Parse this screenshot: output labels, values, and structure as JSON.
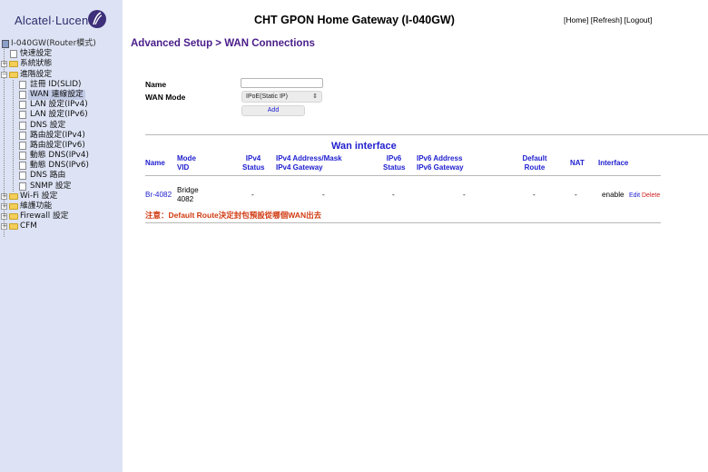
{
  "header": {
    "logo_text": "Alcatel·Lucent",
    "title": "CHT GPON Home Gateway (I-040GW)",
    "links": {
      "home": "[Home]",
      "refresh": "[Refresh]",
      "logout": "[Logout]"
    }
  },
  "sidebar": {
    "root": "I-040GW(Router模式)",
    "items": [
      {
        "label": "快速設定"
      },
      {
        "label": "系統狀態"
      },
      {
        "label": "進階設定"
      },
      {
        "label": "註冊 ID(SLID)"
      },
      {
        "label": "WAN 連線設定"
      },
      {
        "label": "LAN 設定(IPv4)"
      },
      {
        "label": "LAN 設定(IPv6)"
      },
      {
        "label": "DNS 設定"
      },
      {
        "label": "路由設定(IPv4)"
      },
      {
        "label": "路由設定(IPv6)"
      },
      {
        "label": "動態 DNS(IPv4)"
      },
      {
        "label": "動態 DNS(IPv6)"
      },
      {
        "label": "DNS 路由"
      },
      {
        "label": "SNMP 設定"
      },
      {
        "label": "Wi-Fi 設定"
      },
      {
        "label": "維護功能"
      },
      {
        "label": "Firewall 設定"
      },
      {
        "label": "CFM"
      }
    ]
  },
  "main": {
    "breadcrumb": "Advanced Setup > WAN Connections",
    "form": {
      "name_label": "Name",
      "name_value": "",
      "wan_mode_label": "WAN Mode",
      "wan_mode_value": "IPoE(Static IP)",
      "add_label": "Add"
    },
    "wan_table": {
      "title": "Wan interface",
      "headers": {
        "name": "Name",
        "mode": "Mode",
        "vid": "VID",
        "ipv4_status_1": "IPv4",
        "ipv4_status_2": "Status",
        "ipv4_addr_1": "IPv4 Address/Mask",
        "ipv4_addr_2": "IPv4 Gateway",
        "ipv6_status_1": "IPv6",
        "ipv6_status_2": "Status",
        "ipv6_addr_1": "IPv6 Address",
        "ipv6_addr_2": "IPv6 Gateway",
        "default_route_1": "Default",
        "default_route_2": "Route",
        "nat": "NAT",
        "interface": "Interface"
      },
      "rows": [
        {
          "name": "Br-4082",
          "mode": "Bridge",
          "vid": "4082",
          "ipv4_status": "-",
          "ipv4_address": "-",
          "ipv6_status": "-",
          "ipv6_address": "-",
          "default_route": "-",
          "nat": "-",
          "interface": "enable",
          "edit": "Edit",
          "delete": "Delete"
        }
      ]
    },
    "note": "注意：Default Route決定封包預設從哪個WAN出去"
  },
  "colors": {
    "sidebar_bg": "#dde3f4",
    "breadcrumb": "#4a1d8a",
    "table_header": "#2020d0",
    "note": "#d03a10",
    "delete": "#d02020"
  }
}
